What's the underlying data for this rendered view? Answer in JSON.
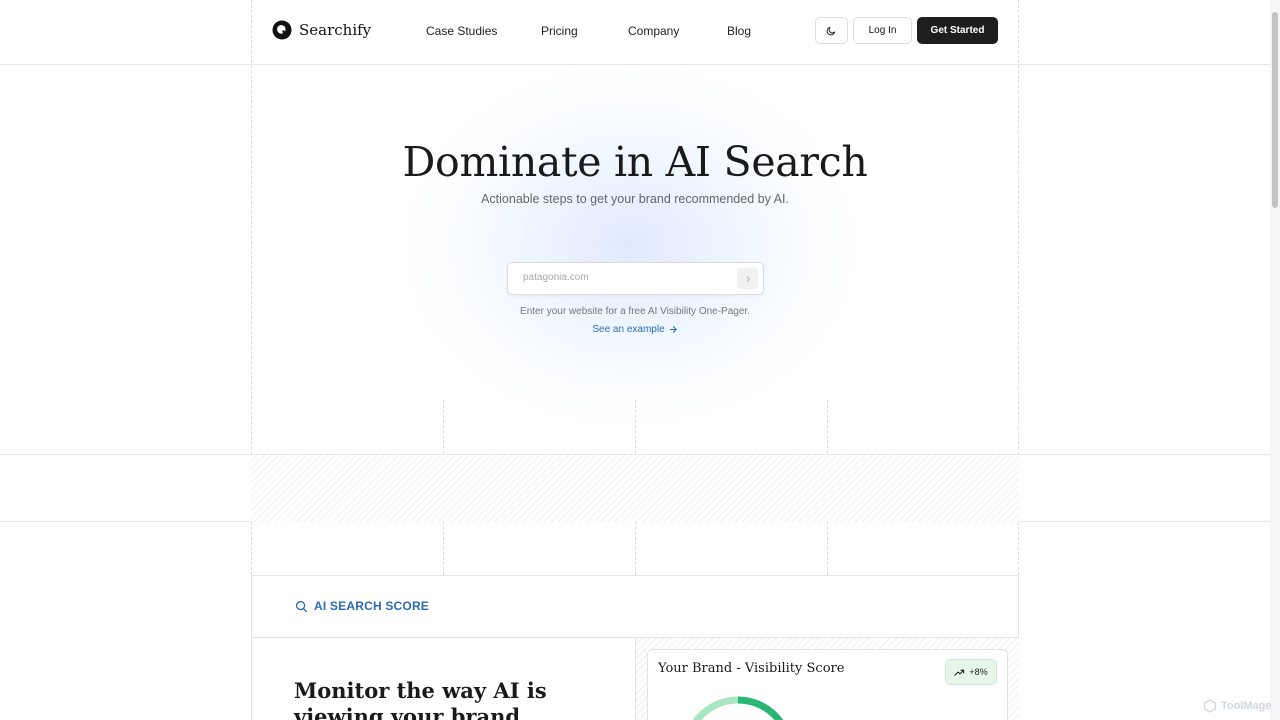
{
  "brand": {
    "name": "Searchify"
  },
  "nav": {
    "items": [
      {
        "label": "Case Studies"
      },
      {
        "label": "Pricing"
      },
      {
        "label": "Company"
      },
      {
        "label": "Blog"
      }
    ],
    "login_label": "Log In",
    "cta_label": "Get Started"
  },
  "hero": {
    "title": "Dominate in AI Search",
    "subtitle": "Actionable steps to get your brand recommended by AI.",
    "search": {
      "placeholder": "patagonia.com",
      "value": ""
    },
    "hint": "Enter your website for a free AI Visibility One-Pager.",
    "example_link": "See an example"
  },
  "score_section": {
    "label": "AI SEARCH SCORE",
    "heading": "Monitor the way AI is viewing your brand",
    "card": {
      "title": "Your Brand - Visibility Score",
      "change": "+8%"
    }
  },
  "watermark": "ToolMage",
  "colors": {
    "accent_blue": "#2b6cb0",
    "dark_button": "#1e1e1e",
    "gauge_green": "#2ab673",
    "gauge_light": "#a8e6c2",
    "badge_bg": "#e6f7ea"
  },
  "icons": {
    "logo": "searchify-q-logo",
    "theme": "moon-icon",
    "submit": "chevron-right-icon",
    "example": "arrow-right-icon",
    "score": "search-icon",
    "trend": "trending-up-icon"
  }
}
